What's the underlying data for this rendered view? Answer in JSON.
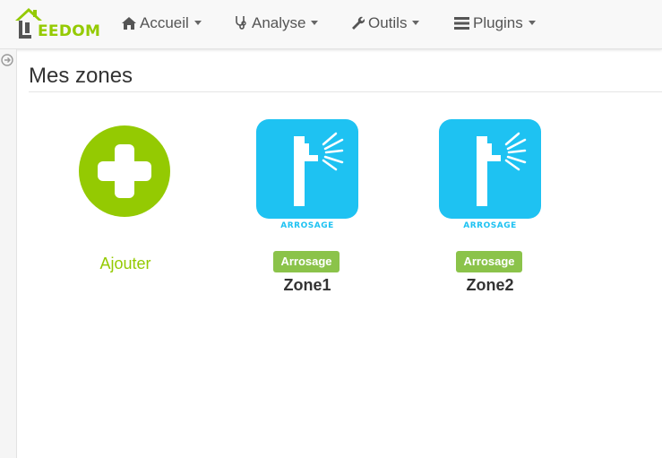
{
  "app": {
    "brand_letter": "J",
    "brand_text": "EEDOM",
    "brand_color": "#94ca02"
  },
  "navbar": {
    "items": [
      {
        "label": "Accueil",
        "icon": "home-icon"
      },
      {
        "label": "Analyse",
        "icon": "stethoscope-icon"
      },
      {
        "label": "Outils",
        "icon": "wrench-icon"
      },
      {
        "label": "Plugins",
        "icon": "list-icon"
      }
    ]
  },
  "sidebar": {
    "toggle_icon": "arrow-circle-right-icon"
  },
  "page": {
    "title": "Mes zones"
  },
  "add_card": {
    "label": "Ajouter",
    "icon": "plus-circle-icon",
    "color": "#94ca02"
  },
  "zones": [
    {
      "name": "Zone1",
      "badge": "Arrosage",
      "icon_caption": "ARROSAGE",
      "icon": "sprinkler-icon"
    },
    {
      "name": "Zone2",
      "badge": "Arrosage",
      "icon_caption": "ARROSAGE",
      "icon": "sprinkler-icon"
    }
  ],
  "colors": {
    "zone_icon_bg": "#1ec2f2",
    "badge_bg": "#8bc34a"
  }
}
